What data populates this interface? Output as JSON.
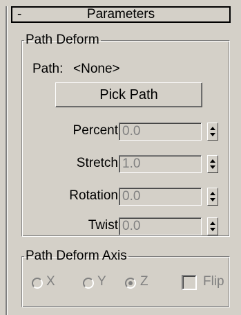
{
  "rollout": {
    "toggle": "-",
    "title": "Parameters"
  },
  "path_deform": {
    "group_title": "Path Deform",
    "path_label": "Path:",
    "path_value": "<None>",
    "pick_path_label": "Pick Path",
    "spinners": [
      {
        "label": "Percent",
        "value": "0.0"
      },
      {
        "label": "Stretch",
        "value": "1.0"
      },
      {
        "label": "Rotation",
        "value": "0.0"
      },
      {
        "label": "Twist",
        "value": "0.0"
      }
    ]
  },
  "path_deform_axis": {
    "group_title": "Path Deform Axis",
    "axes": [
      {
        "label": "X",
        "selected": false
      },
      {
        "label": "Y",
        "selected": false
      },
      {
        "label": "Z",
        "selected": true
      }
    ],
    "flip_label": "Flip",
    "flip_checked": false
  },
  "colors": {
    "panel_bg": "#d4d0c8",
    "disabled_text": "#808080"
  }
}
